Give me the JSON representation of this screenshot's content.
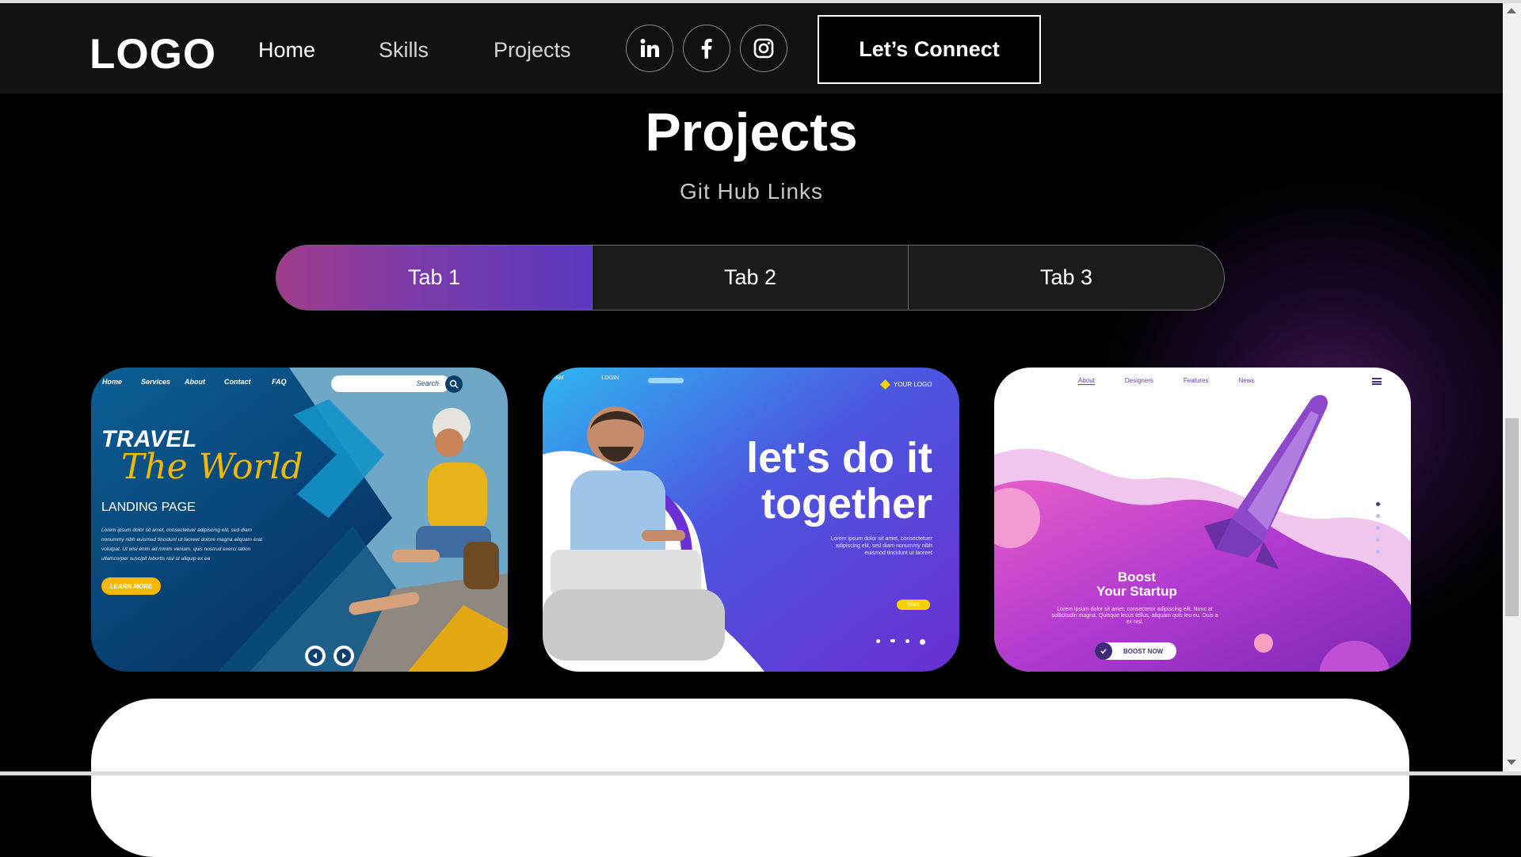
{
  "header": {
    "logo": "LOGO",
    "nav": [
      "Home",
      "Skills",
      "Projects"
    ],
    "social": [
      "linkedin-icon",
      "facebook-icon",
      "instagram-icon"
    ],
    "cta": "Let’s Connect"
  },
  "section": {
    "title": "Projects",
    "subtitle": "Git Hub Links",
    "tabs": [
      "Tab 1",
      "Tab 2",
      "Tab 3"
    ],
    "active_tab": "Tab 1"
  },
  "cards": [
    {
      "nav": [
        "Home",
        "Services",
        "About",
        "Contact",
        "FAQ"
      ],
      "search": "Search",
      "headline1": "TRAVEL",
      "headline2": "The World",
      "headline3": "LANDING PAGE",
      "body": "Lorem ipsum dolor sit amet, consectetuer adipiscing elit, sed diam nonummy nibh euismod tincidunt ut laoreet dolore magna aliquam erat volutpat. Ut wisi enim ad minim veniam, quis nostrud exerci tation ullamcorper suscipit lobortis nisl ut aliquip ex ea",
      "button": "LEARN MORE"
    },
    {
      "nav": [
        "FAM",
        "LOGIN"
      ],
      "logo": "YOUR LOGO",
      "headline1": "let's do it",
      "headline2": "together",
      "body": "Lorem ipsum dolor sit amet, consectetuer adipiscing elit, sed diam nonummy nibh euismod tincidunt ut laoreet",
      "button": "Start"
    },
    {
      "nav": [
        "About",
        "Designers",
        "Features",
        "News"
      ],
      "headline1": "Boost",
      "headline2": "Your Startup",
      "body": "Lorem ipsum dolor sit amet, consectetur adipiscing elit. Nunc at sollicitudin magna. Quisque lecus tellus, aliquam quis leo eu. Duis a ex nisl.",
      "button": "BOOST NOW"
    }
  ],
  "colors": {
    "accent_start": "#a13c8c",
    "accent_end": "#5a38c0",
    "navbar_bg": "#121212"
  }
}
